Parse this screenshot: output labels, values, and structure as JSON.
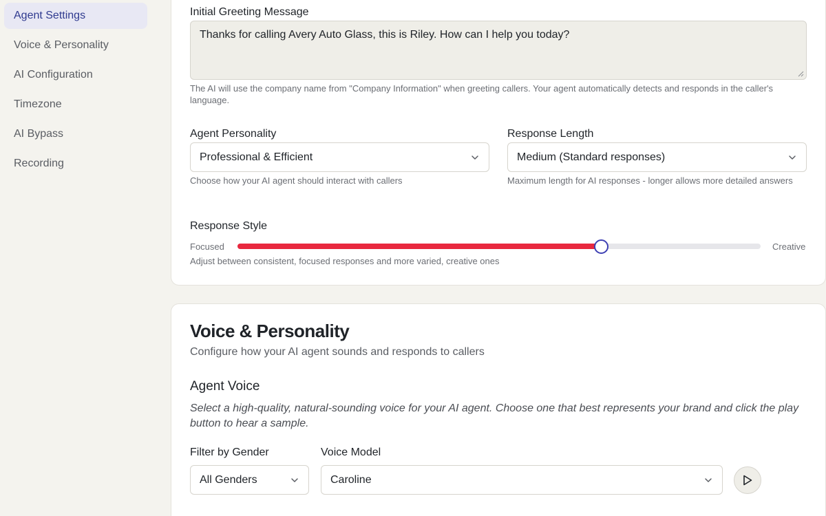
{
  "sidebar": {
    "items": [
      {
        "label": "Agent Settings",
        "active": true
      },
      {
        "label": "Voice & Personality",
        "active": false
      },
      {
        "label": "AI Configuration",
        "active": false
      },
      {
        "label": "Timezone",
        "active": false
      },
      {
        "label": "AI Bypass",
        "active": false
      },
      {
        "label": "Recording",
        "active": false
      }
    ]
  },
  "greeting": {
    "label": "Initial Greeting Message",
    "value": "Thanks for calling Avery Auto Glass, this is Riley. How can I help you today?",
    "help": "The AI will use the company name from \"Company Information\" when greeting callers. Your agent automatically detects and responds in the caller's language."
  },
  "personality": {
    "label": "Agent Personality",
    "selected": "Professional & Efficient",
    "help": "Choose how your AI agent should interact with callers"
  },
  "response_length": {
    "label": "Response Length",
    "selected": "Medium (Standard responses)",
    "help": "Maximum length for AI responses - longer allows more detailed answers"
  },
  "response_style": {
    "label": "Response Style",
    "min_label": "Focused",
    "max_label": "Creative",
    "value_fraction": 0.695,
    "help": "Adjust between consistent, focused responses and more varied, creative ones"
  },
  "voice_section": {
    "title": "Voice & Personality",
    "subtitle": "Configure how your AI agent sounds and responds to callers",
    "agent_voice_title": "Agent Voice",
    "agent_voice_desc": "Select a high-quality, natural-sounding voice for your AI agent. Choose one that best represents your brand and click the play button to hear a sample.",
    "gender_label": "Filter by Gender",
    "gender_selected": "All Genders",
    "model_label": "Voice Model",
    "model_selected": "Caroline"
  },
  "icons": {
    "chevron": "chevron-down-icon",
    "play": "play-icon",
    "resize": "resize-grip-icon"
  },
  "colors": {
    "accent": "#e8283f",
    "thumb_border": "#3d3fb3",
    "active_nav_bg": "#e8e8f4",
    "active_nav_text": "#2f3a8f"
  }
}
